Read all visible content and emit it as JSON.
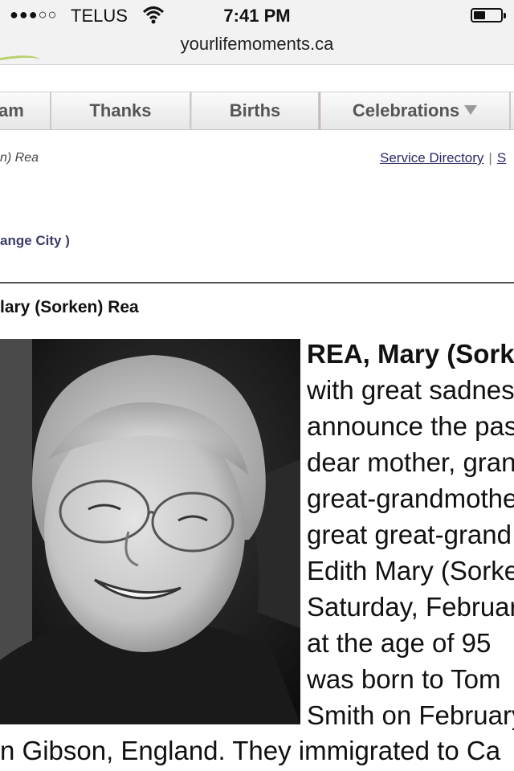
{
  "status_bar": {
    "signal_dots": "●●●○○",
    "carrier": "TELUS",
    "wifi_icon": "wifi-icon",
    "time": "7:41 PM",
    "battery_icon": "battery-icon",
    "battery_level": 0.45
  },
  "browser": {
    "url": "yourlifemoments.ca"
  },
  "nav": {
    "tabs": [
      {
        "label": "am"
      },
      {
        "label": "Thanks"
      },
      {
        "label": "Births"
      },
      {
        "label": "Celebrations",
        "icon": "dropdown-arrow-icon"
      }
    ]
  },
  "breadcrumb": "n) Rea",
  "links": {
    "service_directory": "Service Directory",
    "separator": "|",
    "next_partial": "S"
  },
  "location": "ange City )",
  "obituary": {
    "heading": "lary (Sorken) Rea",
    "lines": [
      "REA, Mary (Sorken)",
      "with great sadness",
      "announce the passing",
      "dear mother, grand",
      "great-grandmother",
      "great great-grand",
      "Edith Mary (Sorken)",
      "Saturday, February",
      "at the age of 95",
      "was born to Tom",
      "Smith on February"
    ],
    "tail": "n Gibson, England. They immigrated to Ca"
  },
  "colors": {
    "link": "#2a2a66",
    "city": "#3b3b6b",
    "nav_text": "#555555",
    "accent_swoosh": "#b9d06a"
  }
}
